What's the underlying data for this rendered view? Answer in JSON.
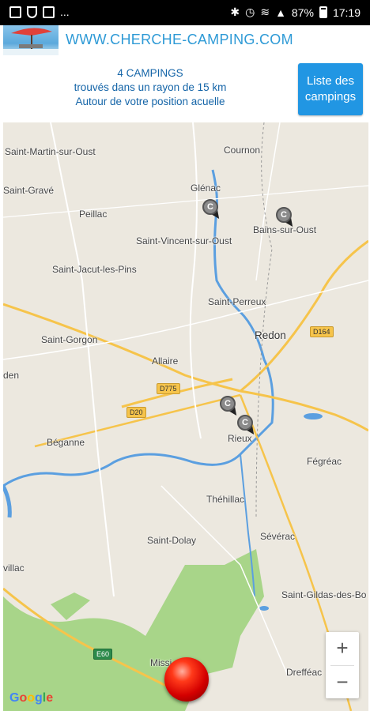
{
  "status_bar": {
    "ellipsis": "...",
    "battery": "87%",
    "time": "17:19"
  },
  "header": {
    "site_title": "WWW.CHERCHE-CAMPING.COM",
    "logo": "campsite-parasol-logo"
  },
  "results": {
    "count": "4 CAMPINGS",
    "line2": "trouvés dans un rayon de 15 km",
    "line3": "Autour de votre position acuelle"
  },
  "list_button": {
    "label": "Liste des campings"
  },
  "map": {
    "places": [
      "Saint-Martin-sur-Oust",
      "Cournon",
      "Glénac",
      "Saint-Gravé",
      "Peillac",
      "Bains-sur-Oust",
      "Saint-Vincent-sur-Oust",
      "Saint-Jacut-les-Pins",
      "Saint-Perreux",
      "Redon",
      "Saint-Gorgon",
      "Allaire",
      "Béganne",
      "Rieux",
      "Fégréac",
      "Théhillac",
      "Saint-Dolay",
      "Sévérac",
      "Saint-Gildas-des-Bo",
      "Missi",
      "Drefféac",
      "den",
      "villac"
    ],
    "roads": [
      "D164",
      "D775",
      "D20",
      "E60"
    ],
    "pin_letter": "C",
    "zoom_in": "+",
    "zoom_out": "−",
    "attribution": [
      "G",
      "o",
      "o",
      "g",
      "l",
      "e"
    ]
  },
  "colors": {
    "accent": "#2196e3",
    "title_blue": "#2e9ad6",
    "info_blue": "#1565a8",
    "map_land": "#ece8df",
    "forest": "#a8d589",
    "water": "#5b9fe0",
    "road": "#f6c44b"
  },
  "icons": [
    "image-icon",
    "shield-icon",
    "dnd-icon",
    "bluetooth-icon",
    "alarm-icon",
    "wifi-icon",
    "signal-icon",
    "battery-icon",
    "camping-pin-icon",
    "zoom-in-icon",
    "zoom-out-icon",
    "my-location-icon"
  ]
}
